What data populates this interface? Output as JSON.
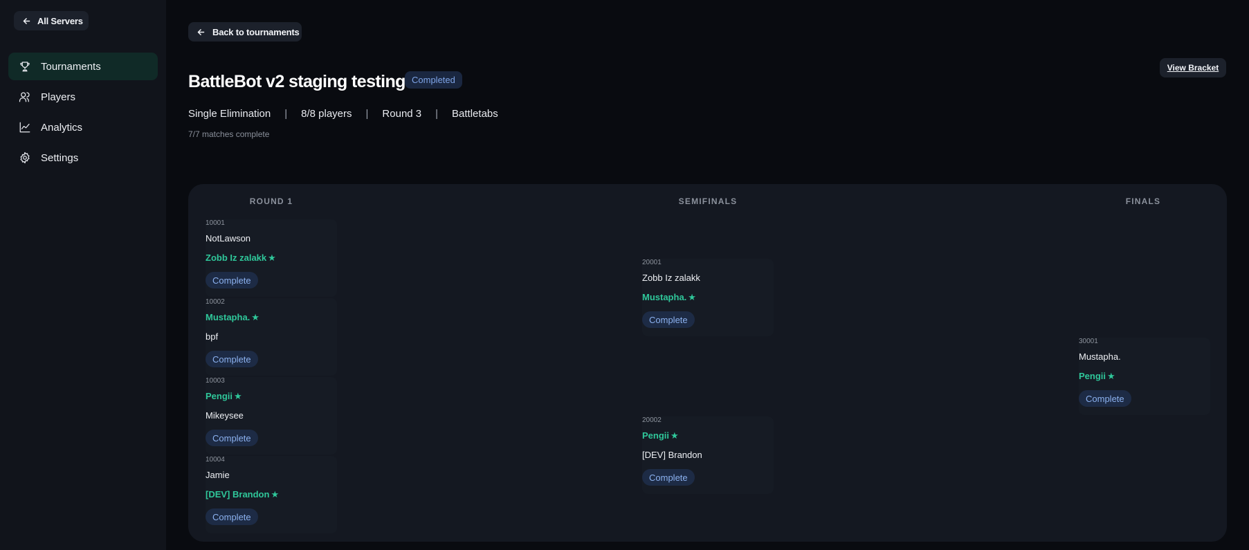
{
  "sidebar": {
    "all_servers": "All Servers",
    "items": [
      {
        "label": "Tournaments",
        "icon": "trophy-icon",
        "active": true
      },
      {
        "label": "Players",
        "icon": "users-icon",
        "active": false
      },
      {
        "label": "Analytics",
        "icon": "chart-line-icon",
        "active": false
      },
      {
        "label": "Settings",
        "icon": "gear-icon",
        "active": false
      }
    ]
  },
  "header": {
    "back_label": "Back to tournaments",
    "title": "BattleBot v2 staging testing",
    "status": "Completed",
    "view_bracket": "View Bracket",
    "meta": {
      "format": "Single Elimination",
      "players": "8/8 players",
      "round": "Round 3",
      "game": "Battletabs",
      "separator": "|"
    },
    "progress": "7/7 matches complete"
  },
  "bracket": {
    "rounds": [
      {
        "name": "ROUND 1",
        "matches": [
          {
            "id": "10001",
            "p1": "NotLawson",
            "p2": "Zobb Iz zalakk",
            "winner": 2,
            "status": "Complete"
          },
          {
            "id": "10002",
            "p1": "Mustapha.",
            "p2": "bpf",
            "winner": 1,
            "status": "Complete"
          },
          {
            "id": "10003",
            "p1": "Pengii",
            "p2": "Mikeysee",
            "winner": 1,
            "status": "Complete"
          },
          {
            "id": "10004",
            "p1": "Jamie",
            "p2": "[DEV] Brandon",
            "winner": 2,
            "status": "Complete"
          }
        ]
      },
      {
        "name": "SEMIFINALS",
        "matches": [
          {
            "id": "20001",
            "p1": "Zobb Iz zalakk",
            "p2": "Mustapha.",
            "winner": 2,
            "status": "Complete"
          },
          {
            "id": "20002",
            "p1": "Pengii",
            "p2": "[DEV] Brandon",
            "winner": 1,
            "status": "Complete"
          }
        ]
      },
      {
        "name": "FINALS",
        "matches": [
          {
            "id": "30001",
            "p1": "Mustapha.",
            "p2": "Pengii",
            "winner": 2,
            "status": "Complete"
          }
        ]
      }
    ],
    "winner_icon": "star-icon",
    "winner_color": "#2fc79a",
    "badge_color": "#8cb2f0"
  }
}
